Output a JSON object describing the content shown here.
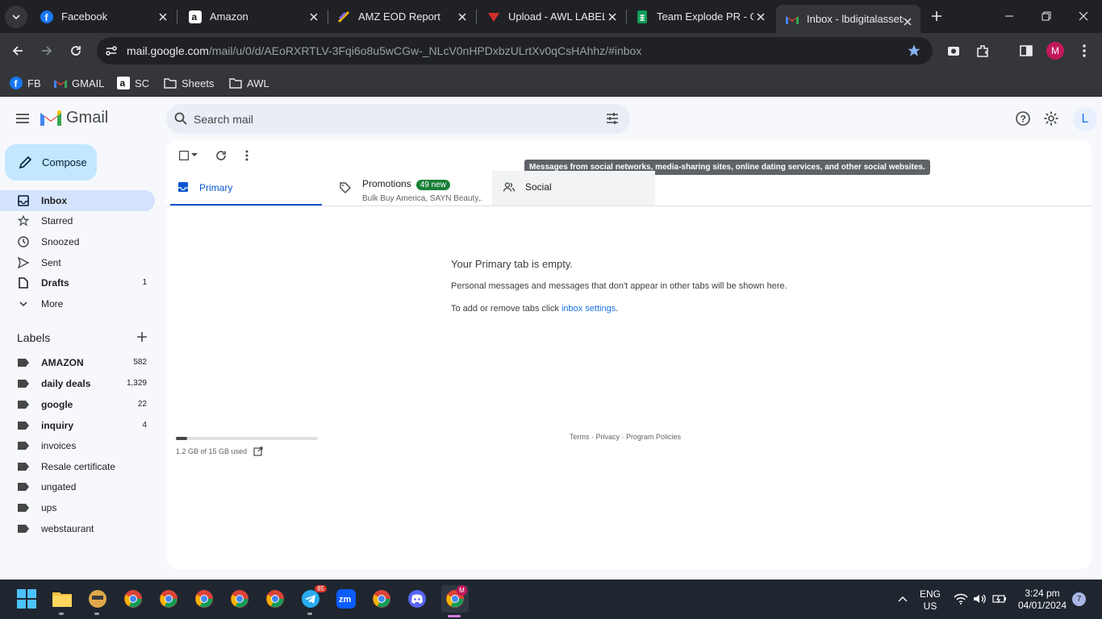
{
  "browser": {
    "tabs": [
      {
        "title": "Facebook",
        "icon": "facebook-icon"
      },
      {
        "title": "Amazon",
        "icon": "amazon-icon"
      },
      {
        "title": "AMZ EOD Report",
        "icon": "clickup-icon"
      },
      {
        "title": "Upload - AWL LABEL",
        "icon": "awl-icon"
      },
      {
        "title": "Team Explode PR - Go",
        "icon": "sheets-icon"
      },
      {
        "title": "Inbox - lbdigitalassets",
        "icon": "gmail-icon"
      }
    ],
    "url_domain": "mail.google.com",
    "url_path": "/mail/u/0/d/AEoRXRTLV-3Fqi6o8u5wCGw-_NLcV0nHPDxbzULrtXv0qCsHAhhz/#inbox",
    "profile_initial": "M",
    "bookmarks": [
      {
        "label": "FB",
        "icon": "facebook-icon"
      },
      {
        "label": "GMAIL",
        "icon": "gmail-icon"
      },
      {
        "label": "SC",
        "icon": "amazon-icon"
      },
      {
        "label": "Sheets",
        "icon": "folder-icon"
      },
      {
        "label": "AWL",
        "icon": "folder-icon"
      }
    ]
  },
  "gmail": {
    "logo_text": "Gmail",
    "search_placeholder": "Search mail",
    "account_initial": "L",
    "compose_label": "Compose",
    "nav": [
      {
        "label": "Inbox",
        "count": "",
        "icon": "inbox-icon",
        "selected": true
      },
      {
        "label": "Starred",
        "count": "",
        "icon": "star-icon"
      },
      {
        "label": "Snoozed",
        "count": "",
        "icon": "clock-icon"
      },
      {
        "label": "Sent",
        "count": "",
        "icon": "send-icon"
      },
      {
        "label": "Drafts",
        "count": "1",
        "icon": "draft-icon",
        "bold": true
      },
      {
        "label": "More",
        "count": "",
        "icon": "chevron-down-icon"
      }
    ],
    "labels_heading": "Labels",
    "labels": [
      {
        "label": "AMAZON",
        "count": "582",
        "bold": true
      },
      {
        "label": "daily deals",
        "count": "1,329",
        "bold": true
      },
      {
        "label": "google",
        "count": "22",
        "bold": true
      },
      {
        "label": "inquiry",
        "count": "4",
        "bold": true
      },
      {
        "label": "invoices",
        "count": ""
      },
      {
        "label": "Resale certificate",
        "count": ""
      },
      {
        "label": "ungated",
        "count": ""
      },
      {
        "label": "ups",
        "count": ""
      },
      {
        "label": "webstaurant",
        "count": ""
      }
    ],
    "tabs": {
      "primary": "Primary",
      "promotions": "Promotions",
      "promotions_badge": "49 new",
      "promotions_snippet": "Bulk Buy America, SAYN Beauty,...",
      "social": "Social"
    },
    "tooltip": "Messages from social networks, media-sharing sites, online dating services, and other social websites.",
    "empty": {
      "heading": "Your Primary tab is empty.",
      "text": "Personal messages and messages that don't appear in other tabs will be shown here.",
      "settings_prefix": "To add or remove tabs click ",
      "settings_link": "inbox settings",
      "settings_suffix": "."
    },
    "storage": {
      "text": "1.2 GB of 15 GB used",
      "fraction": 0.08
    },
    "footer": "Terms · Privacy · Program Policies"
  },
  "taskbar": {
    "lang_top": "ENG",
    "lang_bottom": "US",
    "time": "3:24 pm",
    "date": "04/01/2024",
    "notif_count": "7",
    "telegram_badge": "85",
    "active_badge": "M"
  },
  "colors": {
    "accent": "#0b57d0",
    "compose_bg": "#c2e7ff",
    "selected_nav": "#d3e3fd",
    "badge_green": "#188038"
  }
}
